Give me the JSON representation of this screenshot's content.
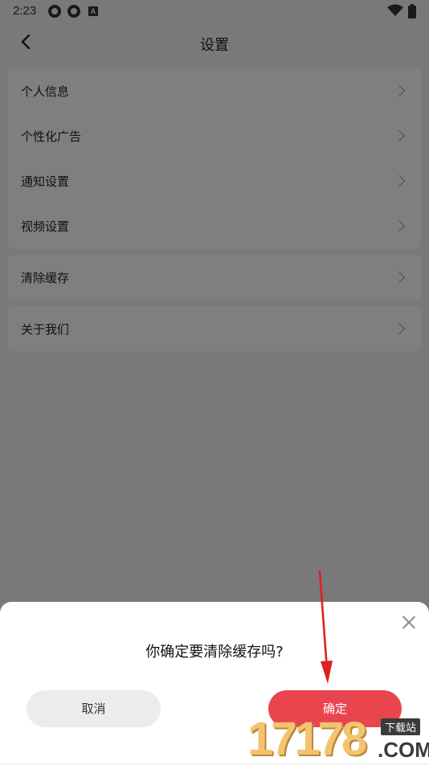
{
  "status_bar": {
    "time": "2:23",
    "icons": [
      "status-circle-icon",
      "status-circle-icon",
      "status-a-icon",
      "wifi-icon",
      "battery-icon"
    ]
  },
  "header": {
    "title": "设置",
    "back_icon": "chevron-left-icon"
  },
  "groups": [
    {
      "items": [
        {
          "label": "个人信息"
        },
        {
          "label": "个性化广告"
        },
        {
          "label": "通知设置"
        },
        {
          "label": "视频设置"
        }
      ]
    },
    {
      "items": [
        {
          "label": "清除缓存"
        }
      ]
    },
    {
      "items": [
        {
          "label": "关于我们"
        }
      ]
    }
  ],
  "dialog": {
    "title": "你确定要清除缓存吗?",
    "cancel_label": "取消",
    "confirm_label": "确定",
    "close_icon": "close-icon"
  },
  "watermark": {
    "digits": "17178",
    "badge": "下载站",
    "domain": ".COM"
  },
  "colors": {
    "background": "#f3f3f3",
    "card": "#ffffff",
    "confirm_button": "#e9454f",
    "cancel_button": "#ececec",
    "arrow": "#e02020",
    "overlay": "rgba(0,0,0,0.5)"
  }
}
